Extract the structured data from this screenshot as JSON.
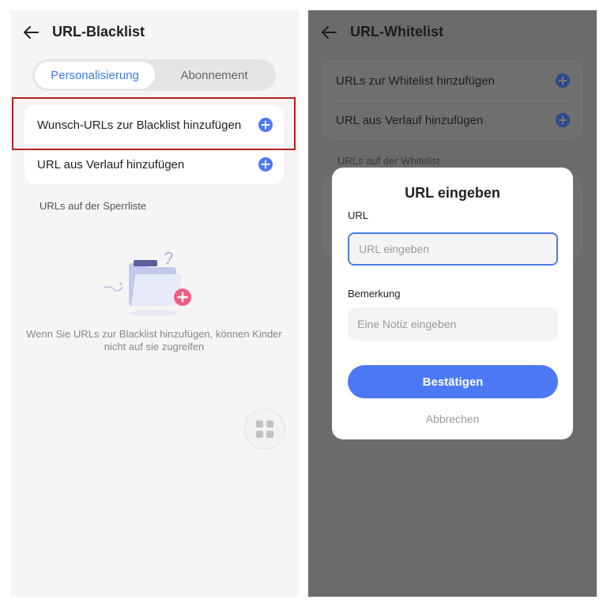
{
  "left_screen": {
    "title": "URL-Blacklist",
    "tabs": [
      {
        "label": "Personalisierung",
        "active": true
      },
      {
        "label": "Abonnement",
        "active": false
      }
    ],
    "rows": [
      {
        "label": "Wunsch-URLs zur Blacklist hinzufügen",
        "icon": "plus-circle-icon"
      },
      {
        "label": "URL aus Verlauf hinzufügen",
        "icon": "plus-circle-icon"
      }
    ],
    "section_label": "URLs auf der Sperrliste",
    "empty_state_text": "Wenn Sie URLs zur Blacklist hinzufügen, können Kinder nicht auf sie zugreifen",
    "floating_button_icon": "grid-icon"
  },
  "right_screen": {
    "title": "URL-Whitelist",
    "rows": [
      {
        "label": "URLs zur Whitelist hinzufügen",
        "icon": "plus-circle-icon"
      },
      {
        "label": "URL aus Verlauf hinzufügen",
        "icon": "plus-circle-icon"
      }
    ],
    "section_label": "URLs auf der Whitelist"
  },
  "dialog": {
    "title": "URL eingeben",
    "url_label": "URL",
    "url_placeholder": "URL eingeben",
    "url_value": "",
    "note_label": "Bemerkung",
    "note_placeholder": "Eine Notiz eingeben",
    "note_value": "",
    "confirm_label": "Bestätigen",
    "cancel_label": "Abbrechen"
  },
  "colors": {
    "accent": "#4c79f3",
    "highlight_border": "#b4231f",
    "overlay": "#6b6b6b"
  }
}
